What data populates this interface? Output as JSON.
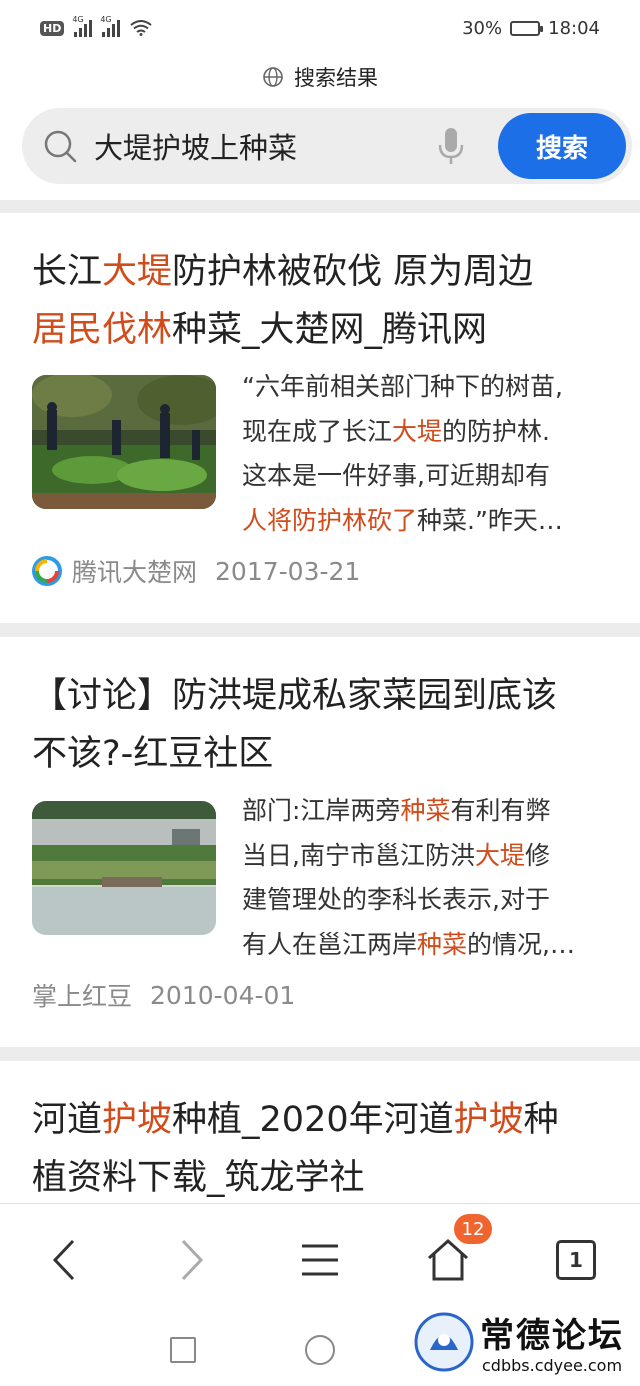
{
  "status": {
    "hd": "HD",
    "net1": "4G",
    "net2": "4G",
    "battery_pct": "30%",
    "battery_level": 0.3,
    "time": "18:04"
  },
  "header": {
    "title": "搜索结果",
    "query": "大堤护坡上种菜",
    "search_button": "搜索"
  },
  "results": [
    {
      "title_parts": [
        "长江",
        "大堤",
        "防护林被砍伐 原为周边",
        "\n",
        "居民伐林",
        "种菜",
        "_大楚网_腾讯网"
      ],
      "snippet_parts": [
        "“六年前相关部门种下的树苗,",
        "\n",
        "现在成了长江",
        "大堤",
        "的防护林.",
        "\n",
        "这本是一件好事,可近期却有",
        "\n",
        "人将防护林砍了",
        "种菜",
        ".”昨天…"
      ],
      "source": "腾讯大楚网",
      "date": "2017-03-21"
    },
    {
      "title_parts": [
        "【讨论】防洪堤成私家菜园到底该",
        "\n",
        "不该?-红豆社区"
      ],
      "snippet_parts": [
        "部门:江岸两旁",
        "种菜",
        "有利有弊",
        "\n",
        "当日,南宁市邕江防洪",
        "大堤",
        "修",
        "\n",
        "建管理处的李科长表示,对于",
        "\n",
        "有人在邕江两岸",
        "种菜",
        "的情况,…"
      ],
      "source": "掌上红豆",
      "date": "2010-04-01"
    },
    {
      "title_parts": [
        "河道",
        "护坡",
        "种植_2020年河道",
        "护坡",
        "种",
        "\n",
        "植资料下载_筑龙学社"
      ]
    }
  ],
  "nav": {
    "badge": "12",
    "tabs": "1"
  },
  "watermark": {
    "text": "常德论坛",
    "url": "cdbbs.cdyee.com"
  },
  "colors": {
    "accent": "#1d6fe8",
    "highlight": "#d14b1b",
    "badge": "#f0652d"
  }
}
